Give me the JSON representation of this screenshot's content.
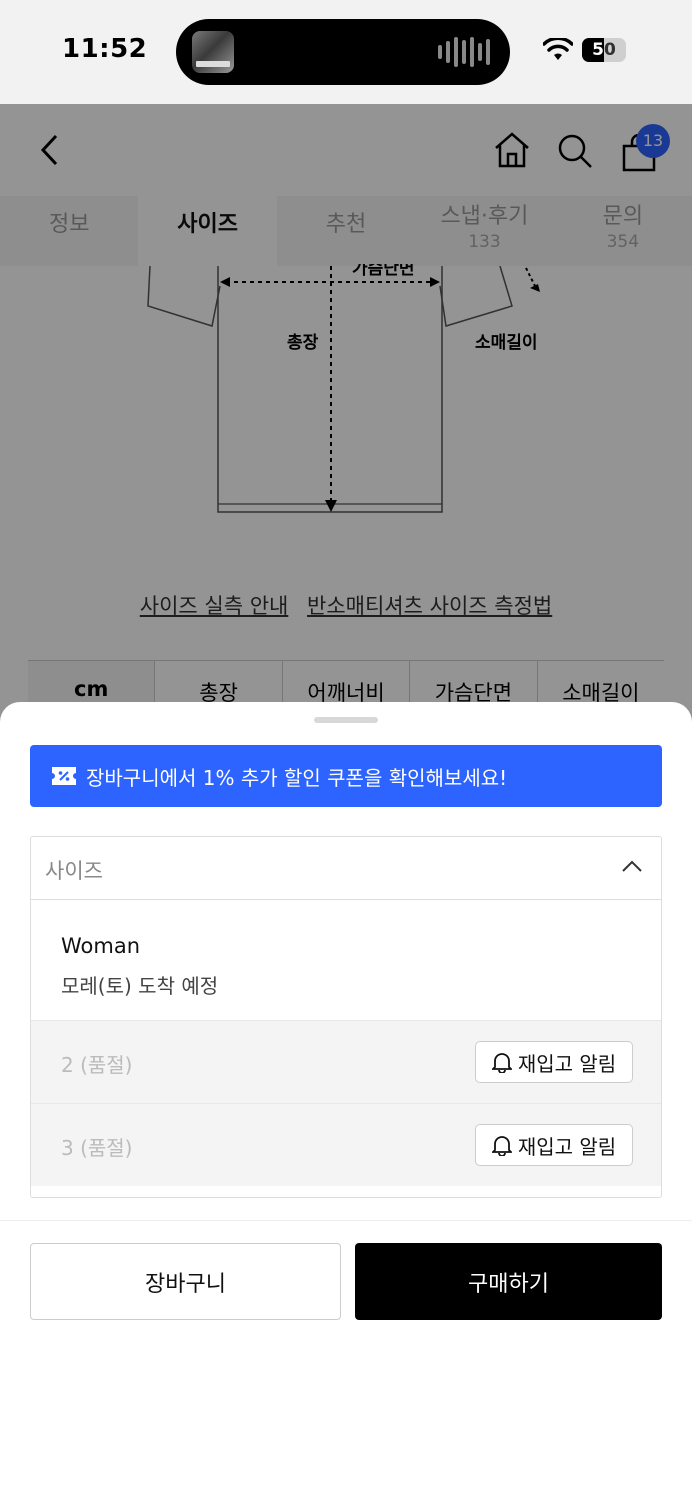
{
  "status_bar": {
    "time": "11:52",
    "battery": "50",
    "battery_level": 0.5
  },
  "appbar": {
    "cart_badge": "13"
  },
  "tabs": [
    {
      "label": "정보",
      "count": ""
    },
    {
      "label": "사이즈",
      "count": ""
    },
    {
      "label": "추천",
      "count": ""
    },
    {
      "label": "스냅·후기",
      "count": "133"
    },
    {
      "label": "문의",
      "count": "354"
    }
  ],
  "diagram": {
    "label_chest": "가슴단면",
    "label_length": "총장",
    "label_sleeve": "소매길이"
  },
  "size_links": {
    "guide": "사이즈 실측 안내",
    "method": "반소매티셔츠 사이즈 측정법"
  },
  "size_table_headers": [
    "cm",
    "총장",
    "어깨너비",
    "가슴단면",
    "소매길이"
  ],
  "sheet": {
    "coupon_text": "장바구니에서 1% 추가 할인 쿠폰을 확인해보세요!",
    "picker_placeholder": "사이즈",
    "group_title": "Woman",
    "group_subtitle": "모레(토) 도착 예정",
    "options": [
      {
        "label": "2 (품절)",
        "button": "재입고 알림"
      },
      {
        "label": "3 (품절)",
        "button": "재입고 알림"
      }
    ],
    "cart_button": "장바구니",
    "buy_button": "구매하기"
  },
  "colors": {
    "accent": "#2d63ff",
    "badge": "#2d63ff",
    "buy": "#000000"
  }
}
